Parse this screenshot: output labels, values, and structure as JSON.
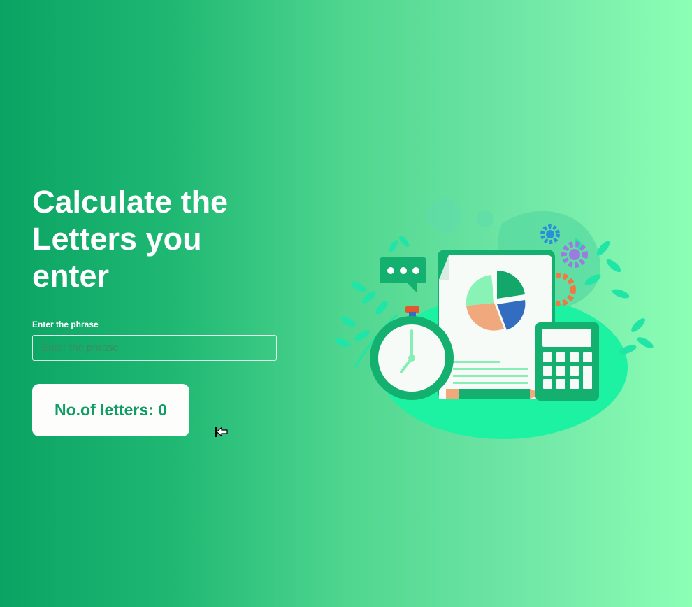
{
  "hero": {
    "title": "Calculate the Letters you enter"
  },
  "form": {
    "phrase_label": "Enter the phrase",
    "phrase_placeholder": "Enter the phrase",
    "phrase_value": ""
  },
  "result": {
    "count_prefix": "No.of letters:",
    "count_value": "0"
  },
  "colors": {
    "accent": "#0e9e63",
    "gradient_start": "#0aa363",
    "gradient_end": "#8cffb5"
  }
}
